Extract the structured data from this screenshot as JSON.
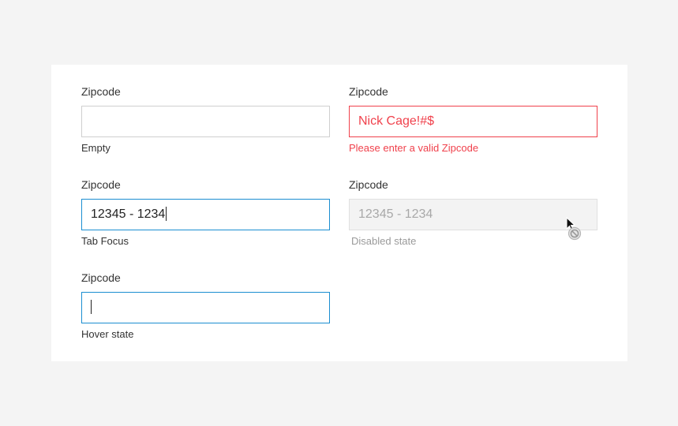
{
  "fields": [
    {
      "label": "Zipcode",
      "value": "",
      "helper": "Empty"
    },
    {
      "label": "Zipcode",
      "value": "Nick Cage!#$",
      "helper": "Please enter a valid Zipcode"
    },
    {
      "label": "Zipcode",
      "value": "12345 - 1234",
      "helper": "Tab Focus"
    },
    {
      "label": "Zipcode",
      "value": "12345 - 1234",
      "helper": "Disabled state"
    },
    {
      "label": "Zipcode",
      "value": "",
      "helper": "Hover state"
    }
  ],
  "colors": {
    "background": "#f4f4f4",
    "card": "#ffffff",
    "error": "#f0414c",
    "focus": "#1b8ed1",
    "disabled_bg": "#f3f3f3",
    "disabled_text": "#a8a8a8"
  },
  "icons": {
    "cursor": "not-allowed-cursor-icon"
  }
}
